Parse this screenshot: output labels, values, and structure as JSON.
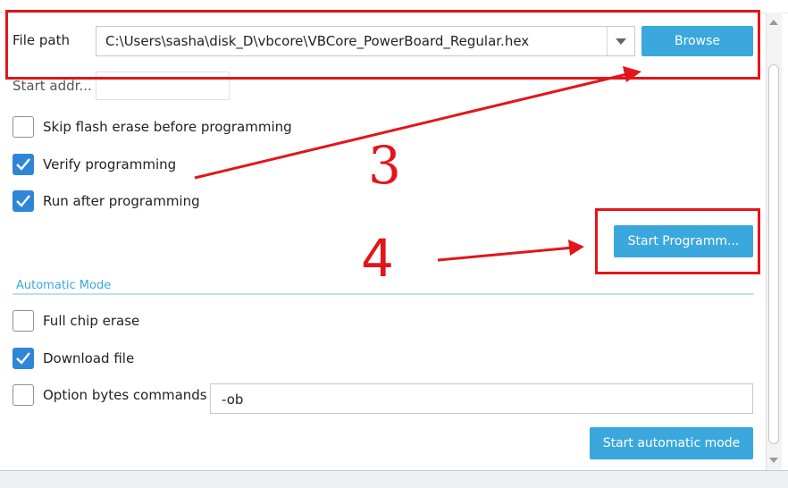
{
  "file_path": {
    "label": "File path",
    "value": "C:\\Users\\sasha\\disk_D\\vbcore\\VBCore_PowerBoard_Regular.hex",
    "browse_label": "Browse"
  },
  "start_address": {
    "label": "Start addr...",
    "value": ""
  },
  "options": {
    "skip_erase": {
      "label": "Skip flash erase before programming",
      "checked": false
    },
    "verify": {
      "label": "Verify programming",
      "checked": true
    },
    "run_after": {
      "label": "Run after programming",
      "checked": true
    }
  },
  "start_programming_label": "Start Programm...",
  "automatic_mode": {
    "title": "Automatic Mode",
    "full_chip_erase": {
      "label": "Full chip erase",
      "checked": false
    },
    "download_file": {
      "label": "Download file",
      "checked": true
    },
    "option_bytes": {
      "label": "Option bytes commands",
      "checked": false,
      "value": "-ob"
    },
    "start_label": "Start automatic mode"
  },
  "annotations": {
    "step3": "3",
    "step4": "4"
  },
  "colors": {
    "accent": "#3aa8dd",
    "annotation": "#e3151b",
    "checkbox": "#2f86d6"
  }
}
